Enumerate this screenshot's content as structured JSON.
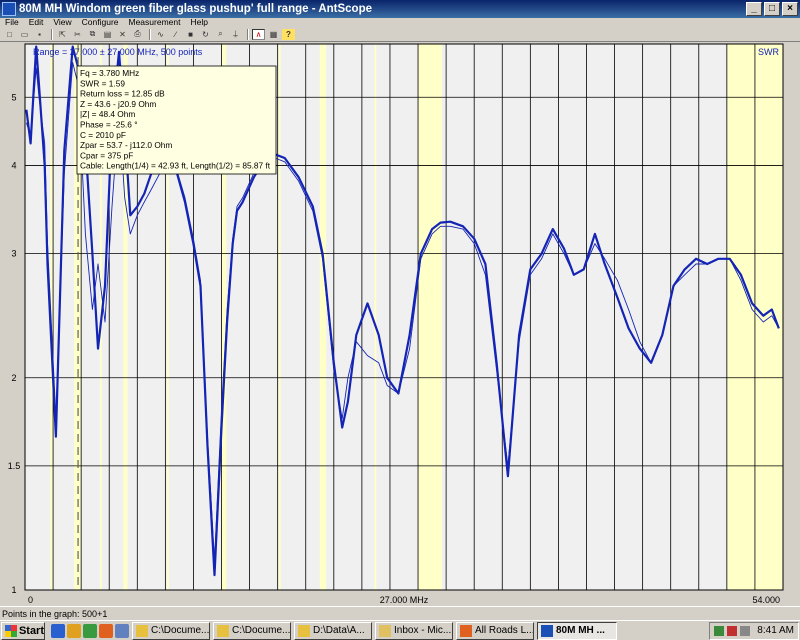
{
  "window": {
    "title": "80M MH Windom green fiber glass pushup' full range - AntScope",
    "minimize": "_",
    "maximize": "□",
    "close": "×"
  },
  "menu": [
    "File",
    "Edit",
    "View",
    "Configure",
    "Measurement",
    "Help"
  ],
  "toolbar_icons": [
    "new-icon",
    "open-icon",
    "save-icon",
    "import-icon",
    "cut-icon",
    "copy-icon",
    "paste-icon",
    "delete-icon",
    "print-icon",
    "scan-icon",
    "single-scan-icon",
    "stop-icon",
    "refresh-icon",
    "zoom-icon",
    "antenna-icon",
    "graph-type-icon",
    "table-icon",
    "help-icon"
  ],
  "plot": {
    "range_label": "Range = 27.000 ± 27.000 MHz, 500 points",
    "metric_label": "SWR",
    "colors": {
      "background": "#f0f0f0",
      "band": "#ffffc8",
      "trace": "#1424b4",
      "grid": "#000000"
    }
  },
  "chart_data": {
    "type": "line",
    "x_ticks": [
      "0",
      "27.000 MHz",
      "54.000"
    ],
    "y_ticks": [
      "1",
      "1.5",
      "2",
      "3",
      "4",
      "5"
    ],
    "xlim": [
      0,
      54
    ],
    "ylim": [
      1,
      5.95
    ],
    "bands": [
      [
        1.8,
        2.0
      ],
      [
        3.5,
        4.0
      ],
      [
        5.33,
        5.41
      ],
      [
        7.0,
        7.3
      ],
      [
        10.1,
        10.15
      ],
      [
        14.0,
        14.35
      ],
      [
        18.07,
        18.17
      ],
      [
        21.0,
        21.45
      ],
      [
        24.89,
        24.99
      ],
      [
        28.0,
        29.7
      ],
      [
        50.0,
        54.0
      ]
    ],
    "cursor_x": 3.78,
    "series": [
      {
        "x": [
          0.1,
          0.4,
          0.8,
          1.0,
          1.4,
          1.6,
          2.2,
          2.8,
          3.4,
          3.8,
          4.3,
          4.8,
          5.2,
          5.7,
          6.2,
          6.7,
          7.1,
          7.5,
          8.0,
          8.5,
          9.0,
          9.6,
          10.1,
          10.8,
          11.4,
          12.0,
          12.5,
          13.0,
          13.5,
          14.0,
          14.4,
          14.8,
          15.1,
          15.5,
          16.3,
          17.0,
          17.8,
          18.5,
          19.5,
          20.5,
          21.2,
          22.0,
          22.6,
          23.0,
          23.6,
          24.4,
          25.2,
          25.8,
          26.6,
          27.4,
          28.2,
          29.0,
          29.6,
          30.3,
          31.2,
          32.0,
          32.8,
          33.6,
          34.4,
          35.2,
          36.0,
          36.8,
          37.6,
          38.4,
          39.1,
          39.8,
          40.6,
          41.3,
          42.2,
          43.0,
          43.8,
          44.6,
          45.4,
          46.2,
          47.0,
          47.8,
          48.6,
          49.4,
          50.2,
          51.0,
          51.8,
          52.6,
          53.2,
          53.7
        ],
        "y": [
          4.8,
          4.3,
          5.9,
          5.2,
          4.0,
          2.9,
          1.65,
          4.2,
          5.9,
          5.5,
          4.3,
          3.0,
          2.2,
          2.7,
          4.6,
          5.8,
          4.5,
          3.4,
          3.5,
          3.65,
          3.9,
          4.0,
          4.02,
          3.92,
          3.55,
          3.1,
          2.7,
          1.6,
          1.05,
          1.7,
          2.4,
          3.1,
          3.45,
          3.55,
          3.85,
          4.05,
          4.15,
          4.1,
          3.85,
          3.5,
          3.0,
          2.1,
          1.7,
          1.85,
          2.3,
          2.55,
          2.3,
          2.0,
          1.9,
          2.3,
          3.0,
          3.25,
          3.32,
          3.33,
          3.28,
          3.15,
          2.9,
          2.1,
          1.45,
          2.3,
          2.85,
          3.0,
          3.25,
          3.05,
          2.8,
          2.85,
          3.2,
          2.9,
          2.6,
          2.35,
          2.2,
          2.1,
          2.3,
          2.7,
          2.85,
          2.95,
          2.9,
          2.95,
          2.95,
          2.8,
          2.55,
          2.45,
          2.5,
          2.35
        ]
      },
      {
        "x": [
          0.1,
          0.4,
          0.8,
          1.0,
          1.4,
          1.6,
          2.2,
          2.8,
          3.4,
          3.8,
          4.3,
          4.8,
          5.2,
          5.7,
          6.2,
          6.7,
          7.1,
          7.5,
          8.0,
          8.5,
          9.0,
          9.6,
          10.1,
          10.8,
          11.4,
          12.0,
          12.5,
          13.0,
          13.5,
          14.0,
          14.4,
          14.8,
          15.1,
          15.5,
          16.3,
          17.0,
          17.8,
          18.5,
          19.5,
          20.5,
          21.2,
          22.0,
          22.6,
          23.0,
          23.6,
          24.4,
          25.2,
          25.8,
          26.6,
          27.4,
          28.2,
          29.0,
          29.6,
          30.3,
          31.2,
          32.0,
          32.8,
          33.6,
          34.4,
          35.2,
          36.0,
          36.8,
          37.6,
          38.4,
          39.1,
          39.8,
          40.6,
          41.3,
          42.2,
          43.0,
          43.8,
          44.6,
          45.4,
          46.2,
          47.0,
          47.8,
          48.6,
          49.4,
          50.2,
          51.0,
          51.8,
          52.6,
          53.2,
          53.7
        ],
        "y": [
          4.6,
          4.4,
          5.5,
          5.0,
          4.3,
          3.1,
          1.75,
          3.9,
          5.6,
          5.2,
          3.2,
          2.5,
          2.9,
          2.4,
          3.5,
          4.8,
          3.6,
          3.2,
          3.4,
          3.55,
          3.7,
          3.9,
          3.95,
          3.95,
          3.6,
          3.15,
          2.75,
          1.65,
          1.1,
          1.8,
          2.5,
          3.15,
          3.5,
          3.6,
          3.9,
          4.0,
          4.1,
          4.05,
          3.8,
          3.45,
          2.95,
          2.05,
          1.75,
          2.0,
          2.25,
          2.15,
          2.1,
          1.95,
          1.9,
          2.2,
          2.95,
          3.2,
          3.28,
          3.28,
          3.25,
          3.1,
          2.8,
          2.05,
          1.5,
          2.25,
          2.8,
          2.95,
          3.2,
          3.0,
          2.8,
          2.85,
          3.1,
          2.95,
          2.75,
          2.5,
          2.25,
          2.1,
          2.3,
          2.7,
          2.8,
          2.9,
          2.9,
          2.95,
          2.95,
          2.75,
          2.5,
          2.4,
          2.45,
          2.35
        ]
      }
    ]
  },
  "tooltip": [
    "Fq = 3.780 MHz",
    "SWR = 1.59",
    "Return loss = 12.85 dB",
    "Z = 43.6 - j20.9 Ohm",
    "|Z| = 48.4 Ohm",
    "Phase = -25.6 °",
    "C = 2010 pF",
    "Zpar = 53.7 - j112.0 Ohm",
    "Cpar = 375 pF",
    "Cable: Length(1/4) = 42.93 ft, Length(1/2) = 85.87 ft"
  ],
  "status": "Points in the graph: 500+1",
  "taskbar": {
    "start": "Start",
    "quicklaunch": [
      "ie-icon",
      "outlook-icon",
      "media-icon",
      "firefox-icon",
      "desktop-icon"
    ],
    "tasks": [
      {
        "label": "C:\\Docume...",
        "icon": "folder-icon",
        "color": "#e8c040"
      },
      {
        "label": "C:\\Docume...",
        "icon": "folder-icon",
        "color": "#e8c040"
      },
      {
        "label": "D:\\Data\\A...",
        "icon": "folder-icon",
        "color": "#e8c040"
      },
      {
        "label": "Inbox - Mic...",
        "icon": "mail-icon",
        "color": "#e0c060"
      },
      {
        "label": "All Roads L...",
        "icon": "firefox-icon",
        "color": "#e06020"
      },
      {
        "label": "80M MH ...",
        "icon": "antscope-icon",
        "color": "#1a4fb5",
        "active": true
      }
    ],
    "clock": "8:41 AM"
  }
}
